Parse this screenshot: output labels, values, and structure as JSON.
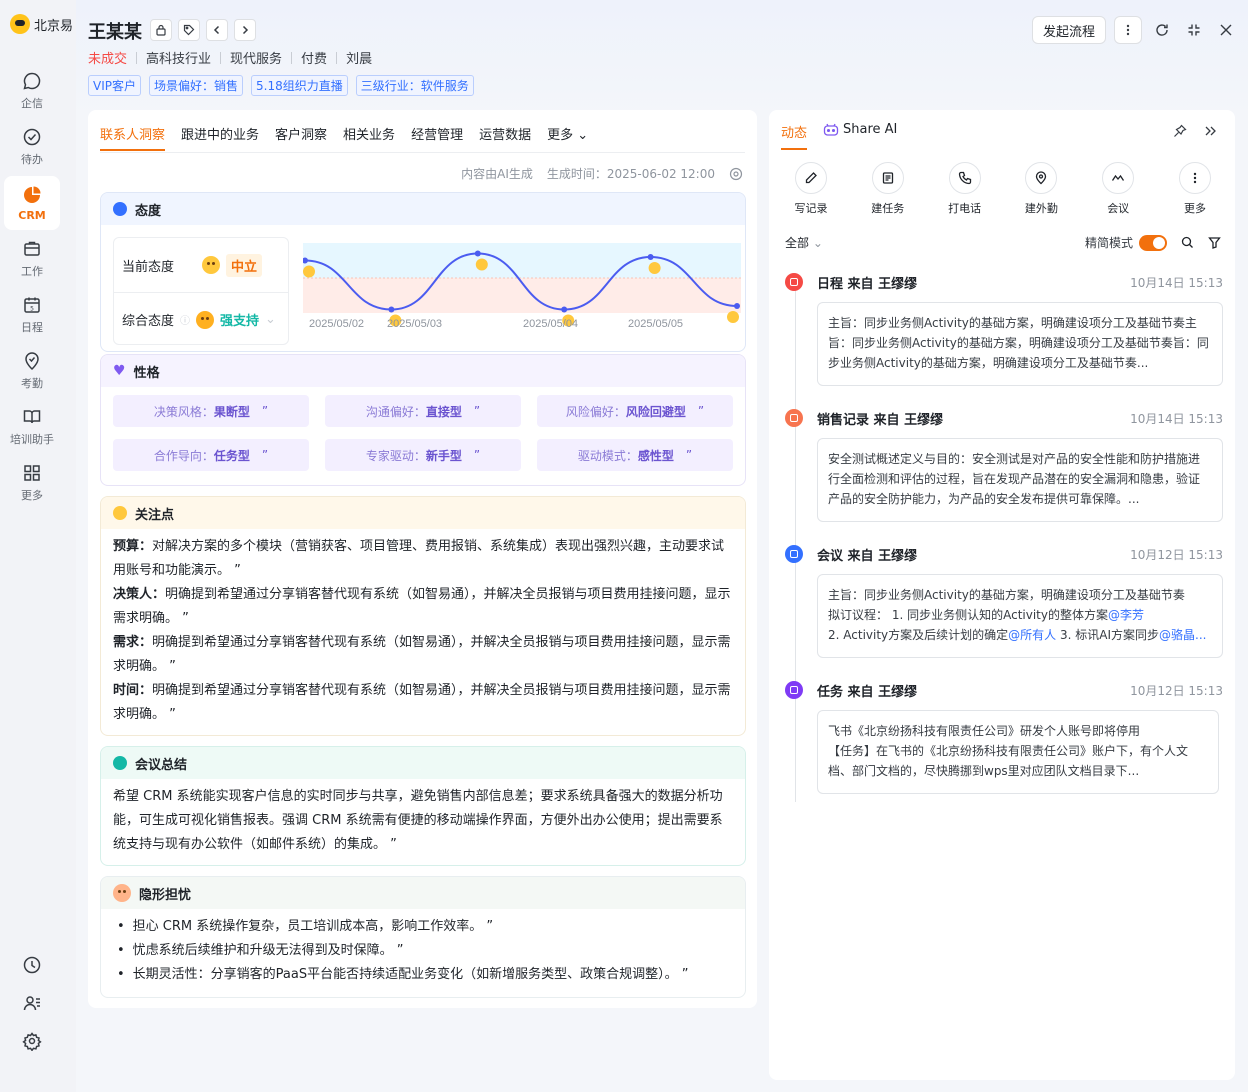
{
  "app": {
    "brand": "北京易"
  },
  "sidebar": {
    "items": [
      {
        "label": "企信",
        "icon": "chat-icon"
      },
      {
        "label": "待办",
        "icon": "check-circle-icon"
      },
      {
        "label": "CRM",
        "icon": "pie-chart-icon"
      },
      {
        "label": "工作",
        "icon": "briefcase-icon"
      },
      {
        "label": "日程",
        "icon": "calendar-icon"
      },
      {
        "label": "考勤",
        "icon": "location-check-icon"
      },
      {
        "label": "培训助手",
        "icon": "book-icon"
      },
      {
        "label": "更多",
        "icon": "grid-icon"
      }
    ]
  },
  "header": {
    "name": "王某某",
    "status": "未成交",
    "meta": [
      "高科技行业",
      "现代服务",
      "付费",
      "刘晨"
    ],
    "tags": [
      "VIP客户",
      "场景偏好：销售",
      "5.18组织力直播",
      "三级行业：软件服务"
    ],
    "primary_action": "发起流程"
  },
  "left": {
    "tabs": [
      "联系人洞察",
      "跟进中的业务",
      "客户洞察",
      "相关业务",
      "经营管理",
      "运营数据",
      "更多"
    ],
    "ai_note": "内容由AI生成",
    "gen_time": "生成时间：2025-06-02 12:00",
    "attitude": {
      "title": "态度",
      "current_label": "当前态度",
      "current_value": "中立",
      "overall_label": "综合态度",
      "overall_value": "强支持"
    },
    "personality": {
      "title": "性格",
      "chips": [
        {
          "k": "决策风格：",
          "v": "果断型"
        },
        {
          "k": "沟通偏好：",
          "v": "直接型"
        },
        {
          "k": "风险偏好：",
          "v": "风险回避型"
        },
        {
          "k": "合作导向：",
          "v": "任务型"
        },
        {
          "k": "专家驱动：",
          "v": "新手型"
        },
        {
          "k": "驱动模式：",
          "v": "感性型"
        }
      ]
    },
    "focus": {
      "title": "关注点",
      "items": [
        {
          "k": "预算：",
          "v": "对解决方案的多个模块（营销获客、项目管理、费用报销、系统集成）表现出强烈兴趣，主动要求试用账号和功能演示。 ”"
        },
        {
          "k": "决策人：",
          "v": "明确提到希望通过分享销客替代现有系统（如智易通），并解决全员报销与项目费用挂接问题，显示需求明确。 ”"
        },
        {
          "k": "需求：",
          "v": "明确提到希望通过分享销客替代现有系统（如智易通），并解决全员报销与项目费用挂接问题，显示需求明确。 ”"
        },
        {
          "k": "时间：",
          "v": "明确提到希望通过分享销客替代现有系统（如智易通），并解决全员报销与项目费用挂接问题，显示需求明确。 ”"
        }
      ]
    },
    "meeting": {
      "title": "会议总结",
      "text": "希望 CRM 系统能实现客户信息的实时同步与共享，避免销售内部信息差；要求系统具备强大的数据分析功能，可生成可视化销售报表。强调 CRM 系统需有便捷的移动端操作界面，方便外出办公使用；提出需要系统支持与现有办公软件（如邮件系统）的集成。 ”"
    },
    "worries": {
      "title": "隐形担忧",
      "items": [
        "担心 CRM 系统操作复杂，员工培训成本高，影响工作效率。 ”",
        "忧虑系统后续维护和升级无法得到及时保障。 ”",
        "长期灵活性：分享销客的PaaS平台能否持续适配业务变化（如新增服务类型、政策合规调整）。 ”"
      ]
    }
  },
  "chart_data": {
    "type": "line",
    "x": [
      "2025/05/02",
      "2025/05/03",
      "2025/05/04",
      "2025/05/05"
    ],
    "x_ticks": [
      "2025/05/02",
      "2025/05/03",
      "2025/05/04",
      "2025/05/05"
    ],
    "series": [
      {
        "values": [
          0.75,
          0.05,
          0.85,
          0.05,
          0.8,
          0.1
        ]
      }
    ],
    "grid": false,
    "bands": [
      "positive",
      "negative"
    ],
    "colors": {
      "line": "#4b5cf0",
      "band_top": "#e6f7ff",
      "band_bottom": "#ffece8"
    }
  },
  "right": {
    "tabs": [
      "动态",
      "Share AI"
    ],
    "actions": [
      {
        "label": "写记录",
        "icon": "pencil-icon"
      },
      {
        "label": "建任务",
        "icon": "task-icon"
      },
      {
        "label": "打电话",
        "icon": "phone-icon"
      },
      {
        "label": "建外勤",
        "icon": "map-pin-icon"
      },
      {
        "label": "会议",
        "icon": "meeting-icon"
      },
      {
        "label": "更多",
        "icon": "more-vertical-icon"
      }
    ],
    "filter": "全部",
    "simple_mode": "精简模式",
    "feed": [
      {
        "type": "日程",
        "from": "来自",
        "who": "王缪缪",
        "time": "10月14日 15:13",
        "color": "#f54a45",
        "lines": [
          "主旨：同步业务侧Activity的基础方案，明确建设项分工及基础节奏主",
          "旨：同步业务侧Activity的基础方案，明确建设项分工及基础节奏旨：同",
          "步业务侧Activity的基础方案，明确建设项分工及基础节奏..."
        ]
      },
      {
        "type": "销售记录",
        "from": "来自",
        "who": "王缪缪",
        "time": "10月14日 15:13",
        "color": "#f7744f",
        "lines": [
          "安全测试概述定义与目的：安全测试是对产品的安全性能和防护措施进",
          "行全面检测和评估的过程，旨在发现产品潜在的安全漏洞和隐患，验证",
          "产品的安全防护能力，为产品的安全发布提供可靠保障。..."
        ]
      },
      {
        "type": "会议",
        "from": "来自",
        "who": "王缪缪",
        "time": "10月12日 15:13",
        "color": "#3370ff",
        "lines": [
          "主旨：同步业务侧Activity的基础方案，明确建设项分工及基础节奏"
        ],
        "agenda_label": "拟订议程：",
        "agenda_1": "1. 同步业务侧认知的Activity的整体方案",
        "mention_1": "@李芳",
        "agenda_2": "2. Activity方案及后续计划的确定",
        "mention_2": "@所有人",
        "agenda_3": "3. 标讯AI方案同步",
        "mention_3": "@骆晶..."
      },
      {
        "type": "任务",
        "from": "来自",
        "who": "王缪缪",
        "time": "10月12日 15:13",
        "color": "#7f3bf5",
        "lines": [
          "飞书《北京纷扬科技有限责任公司》研发个人账号即将停用",
          "【任务】在飞书的《北京纷扬科技有限责任公司》账户下，有个人文",
          "档、部门文档的，尽快腾挪到wps里对应团队文档目录下..."
        ]
      }
    ]
  }
}
